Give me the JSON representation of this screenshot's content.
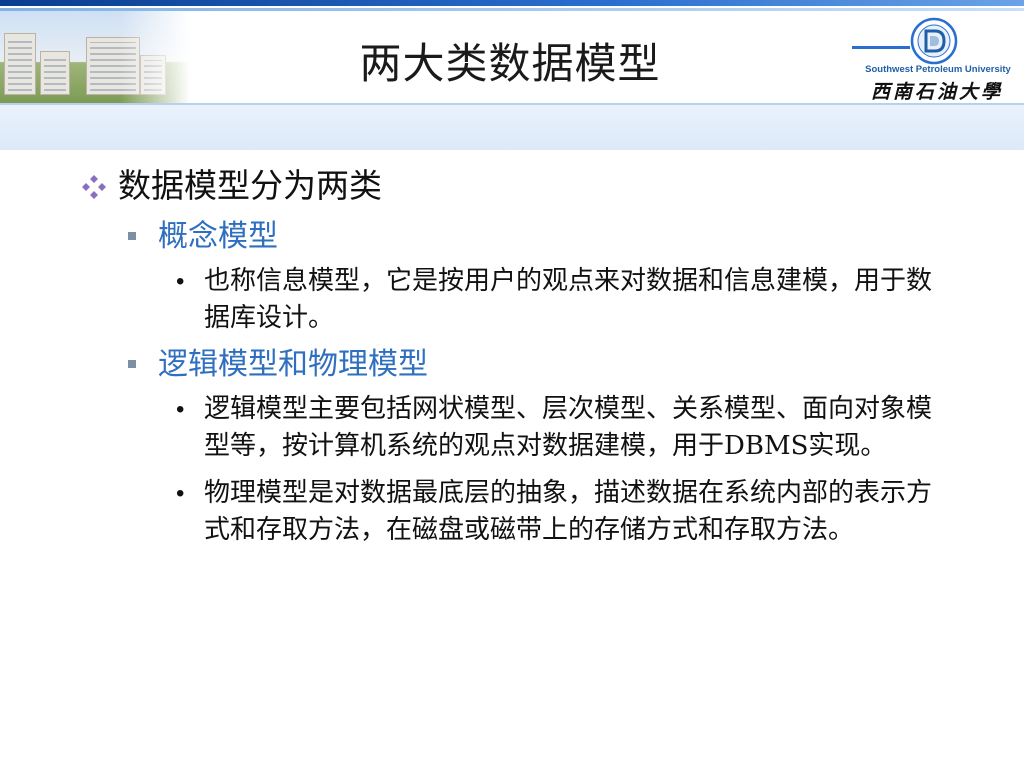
{
  "slide": {
    "title": "两大类数据模型"
  },
  "logo": {
    "english": "Southwest Petroleum University",
    "chinese": "西南石油大學",
    "emblem_icon": "university-emblem-icon"
  },
  "content": {
    "heading": "数据模型分为两类",
    "sections": [
      {
        "label": "概念模型",
        "points": [
          "也称信息模型，它是按用户的观点来对数据和信息建模，用于数据库设计。"
        ]
      },
      {
        "label": "逻辑模型和物理模型",
        "points": [
          "逻辑模型主要包括网状模型、层次模型、关系模型、面向对象模型等，按计算机系统的观点对数据建模，用于DBMS实现。",
          "物理模型是对数据最底层的抽象，描述数据在系统内部的表示方式和存取方法，在磁盘或磁带上的存储方式和存取方法。"
        ]
      }
    ]
  },
  "colors": {
    "accent_blue": "#2f6fbf",
    "bullet_purple": "#8a6fbf",
    "header_band": "#dce9f8"
  }
}
